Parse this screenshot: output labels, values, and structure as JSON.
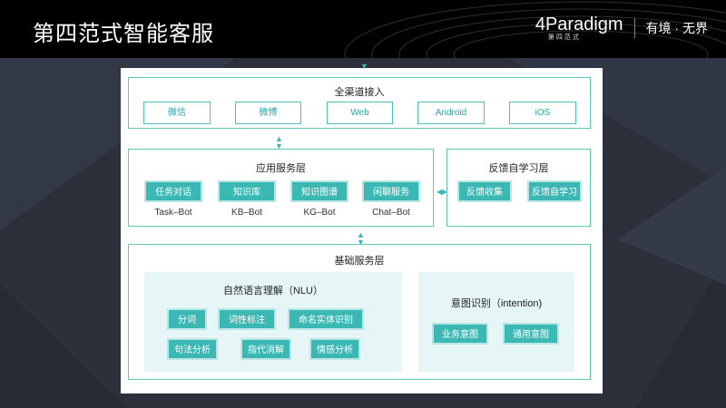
{
  "header": {
    "title": "第四范式智能客服",
    "brand_word": "4Paradigm",
    "brand_sub": "第四范式",
    "slogan": "有境 · 无界"
  },
  "diagram": {
    "access_layer": {
      "title": "全渠道接入",
      "channels": [
        "微信",
        "微博",
        "Web",
        "Android",
        "iOS"
      ]
    },
    "app_layer": {
      "title": "应用服务层",
      "services": [
        {
          "label": "任务对话",
          "caption": "Task–Bot"
        },
        {
          "label": "知识库",
          "caption": "KB–Bot"
        },
        {
          "label": "知识图谱",
          "caption": "KG–Bot"
        },
        {
          "label": "闲聊服务",
          "caption": "Chat–Bot"
        }
      ]
    },
    "feedback_layer": {
      "title": "反馈自学习层",
      "items": [
        "反馈收集",
        "反馈自学习"
      ]
    },
    "base_layer": {
      "title": "基础服务层",
      "nlu": {
        "title": "自然语言理解（NLU）",
        "row1": [
          "分词",
          "词性标注",
          "命名实体识别"
        ],
        "row2": [
          "句法分析",
          "指代消解",
          "情感分析"
        ]
      },
      "intention": {
        "title": "意图识别（intention)",
        "items": [
          "业务意图",
          "通用意图"
        ]
      }
    }
  },
  "colors": {
    "accent": "#3bb8b3",
    "border": "#5ec8c3",
    "header_bg": "#000000",
    "slide_bg": "#2a2f3a"
  }
}
